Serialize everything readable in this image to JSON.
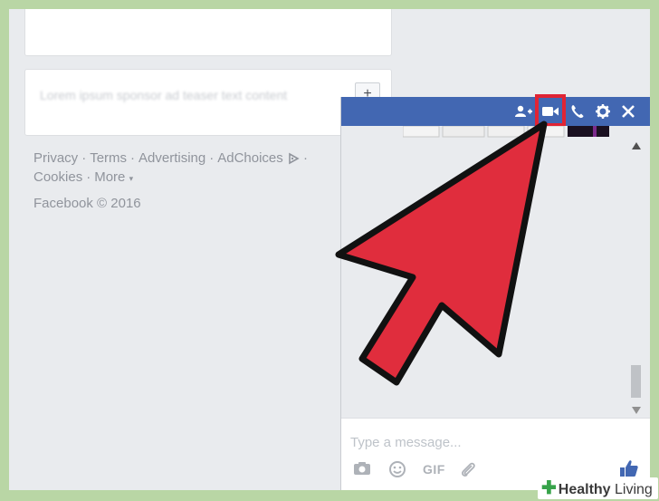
{
  "ad_card": {
    "text": "Lorem ipsum sponsor ad teaser text content",
    "button_label": "+"
  },
  "footer": {
    "links_row1": [
      "Privacy",
      "Terms",
      "Advertising",
      "AdChoices"
    ],
    "links_row2": [
      "Cookies",
      "More"
    ],
    "separator": "·",
    "more_caret": "▾",
    "copyright": "Facebook © 2016"
  },
  "chat": {
    "header_color": "#4267b2",
    "icons": [
      "add-friend-icon",
      "video-call-icon",
      "phone-icon",
      "gear-icon",
      "close-icon"
    ],
    "highlight_color": "#e02434",
    "composer": {
      "placeholder": "Type a message...",
      "gif_label": "GIF",
      "icons": [
        "camera-icon",
        "emoji-icon",
        "attach-icon",
        "like-icon"
      ]
    }
  },
  "annotation": {
    "arrow_color": "#e02d3d",
    "outline_color": "#111111"
  },
  "watermark": {
    "plus": "✚",
    "brand1": "Healthy",
    "brand2": "Living"
  }
}
